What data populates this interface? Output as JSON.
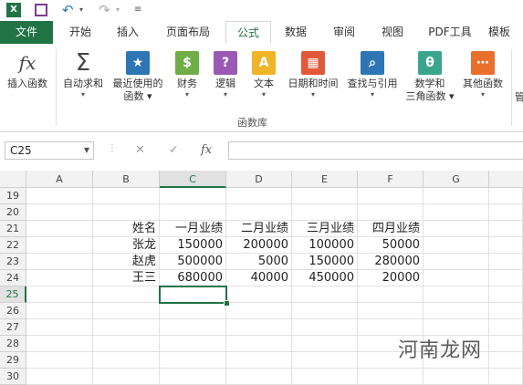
{
  "qat": {
    "icons": [
      "excel-logo-icon",
      "save-icon",
      "undo-icon",
      "redo-icon",
      "customize-qat-icon"
    ]
  },
  "tabs": {
    "file": "文件",
    "items": [
      "开始",
      "插入",
      "页面布局",
      "公式",
      "数据",
      "审阅",
      "视图",
      "PDF工具",
      "模板"
    ],
    "active": "公式"
  },
  "ribbon": {
    "buttons": [
      {
        "label1": "插入函数",
        "label2": "",
        "icon": "fx-icon",
        "color": "#555555"
      },
      {
        "label1": "自动求和",
        "label2": "▾",
        "icon": "sigma-icon",
        "color": "#555555"
      },
      {
        "label1": "最近使用的",
        "label2": "函数 ▾",
        "icon": "star-book-icon",
        "color": "#2e75b6"
      },
      {
        "label1": "财务",
        "label2": "▾",
        "icon": "coins-book-icon",
        "color": "#70ad47"
      },
      {
        "label1": "逻辑",
        "label2": "▾",
        "icon": "question-book-icon",
        "color": "#9b59b6"
      },
      {
        "label1": "文本",
        "label2": "▾",
        "icon": "letter-a-book-icon",
        "color": "#f0b429"
      },
      {
        "label1": "日期和时间",
        "label2": "▾",
        "icon": "calendar-book-icon",
        "color": "#e05a3a"
      },
      {
        "label1": "查找与引用",
        "label2": "▾",
        "icon": "magnifier-book-icon",
        "color": "#2e75b6"
      },
      {
        "label1": "数学和",
        "label2": "三角函数 ▾",
        "icon": "theta-book-icon",
        "color": "#3aa58c"
      },
      {
        "label1": "其他函数",
        "label2": "▾",
        "icon": "more-book-icon",
        "color": "#e86f2c"
      }
    ],
    "group_label": "函数库",
    "cut_label": "管"
  },
  "formula_bar": {
    "name_box": "C25",
    "cancel": "✕",
    "enter": "✓",
    "fx": "fx",
    "content": ""
  },
  "sheet": {
    "columns": [
      "A",
      "B",
      "C",
      "D",
      "E",
      "F",
      "G"
    ],
    "rows": [
      "19",
      "20",
      "21",
      "22",
      "23",
      "24",
      "25",
      "26",
      "27",
      "28",
      "29",
      "30"
    ],
    "selected_cell": "C25",
    "data": {
      "21": [
        "",
        "姓名",
        "一月业绩",
        "二月业绩",
        "三月业绩",
        "四月业绩",
        ""
      ],
      "22": [
        "",
        "张龙",
        "150000",
        "200000",
        "100000",
        "50000",
        ""
      ],
      "23": [
        "",
        "赵虎",
        "500000",
        "5000",
        "150000",
        "280000",
        ""
      ],
      "24": [
        "",
        "王三",
        "680000",
        "40000",
        "450000",
        "20000",
        ""
      ]
    }
  },
  "watermark": "河南龙网"
}
